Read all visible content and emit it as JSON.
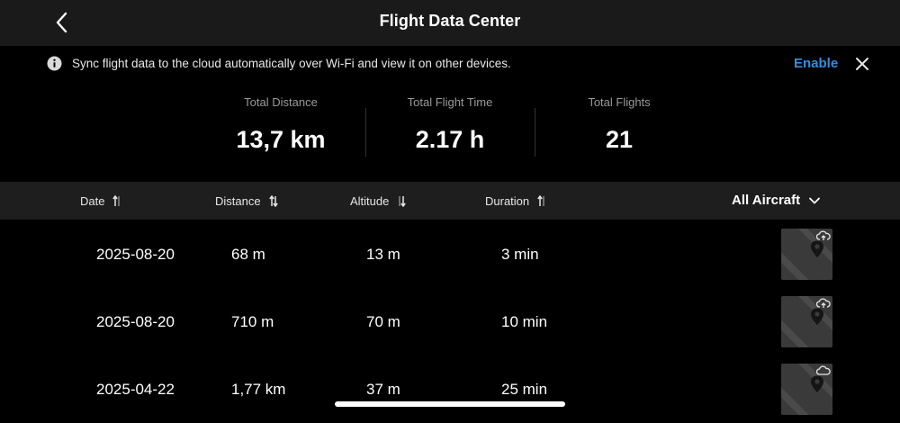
{
  "header": {
    "title": "Flight Data Center",
    "back_icon": "chevron-left-icon"
  },
  "banner": {
    "icon": "info-icon",
    "text": "Sync flight data to the cloud automatically over Wi-Fi and view it on other devices.",
    "enable_label": "Enable",
    "close_icon": "close-icon",
    "accent_color": "#2f8fe6"
  },
  "stats": [
    {
      "label": "Total Distance",
      "value": "13,7 km"
    },
    {
      "label": "Total Flight Time",
      "value": "2.17 h"
    },
    {
      "label": "Total Flights",
      "value": "21"
    }
  ],
  "table": {
    "columns": [
      {
        "label": "Date",
        "sort_icon": "sort-icon"
      },
      {
        "label": "Distance",
        "sort_icon": "sort-icon"
      },
      {
        "label": "Altitude",
        "sort_icon": "sort-icon"
      },
      {
        "label": "Duration",
        "sort_icon": "sort-icon"
      }
    ],
    "filter_label": "All Aircraft",
    "filter_icon": "chevron-down-icon",
    "rows": [
      {
        "date": "2025-08-20",
        "distance": "68 m",
        "altitude": "13 m",
        "duration": "3 min",
        "cloud_icon": "cloud-upload-icon"
      },
      {
        "date": "2025-08-20",
        "distance": "710 m",
        "altitude": "70 m",
        "duration": "10 min",
        "cloud_icon": "cloud-upload-icon"
      },
      {
        "date": "2025-04-22",
        "distance": "1,77 km",
        "altitude": "37 m",
        "duration": "25 min",
        "cloud_icon": "cloud-icon"
      }
    ]
  }
}
